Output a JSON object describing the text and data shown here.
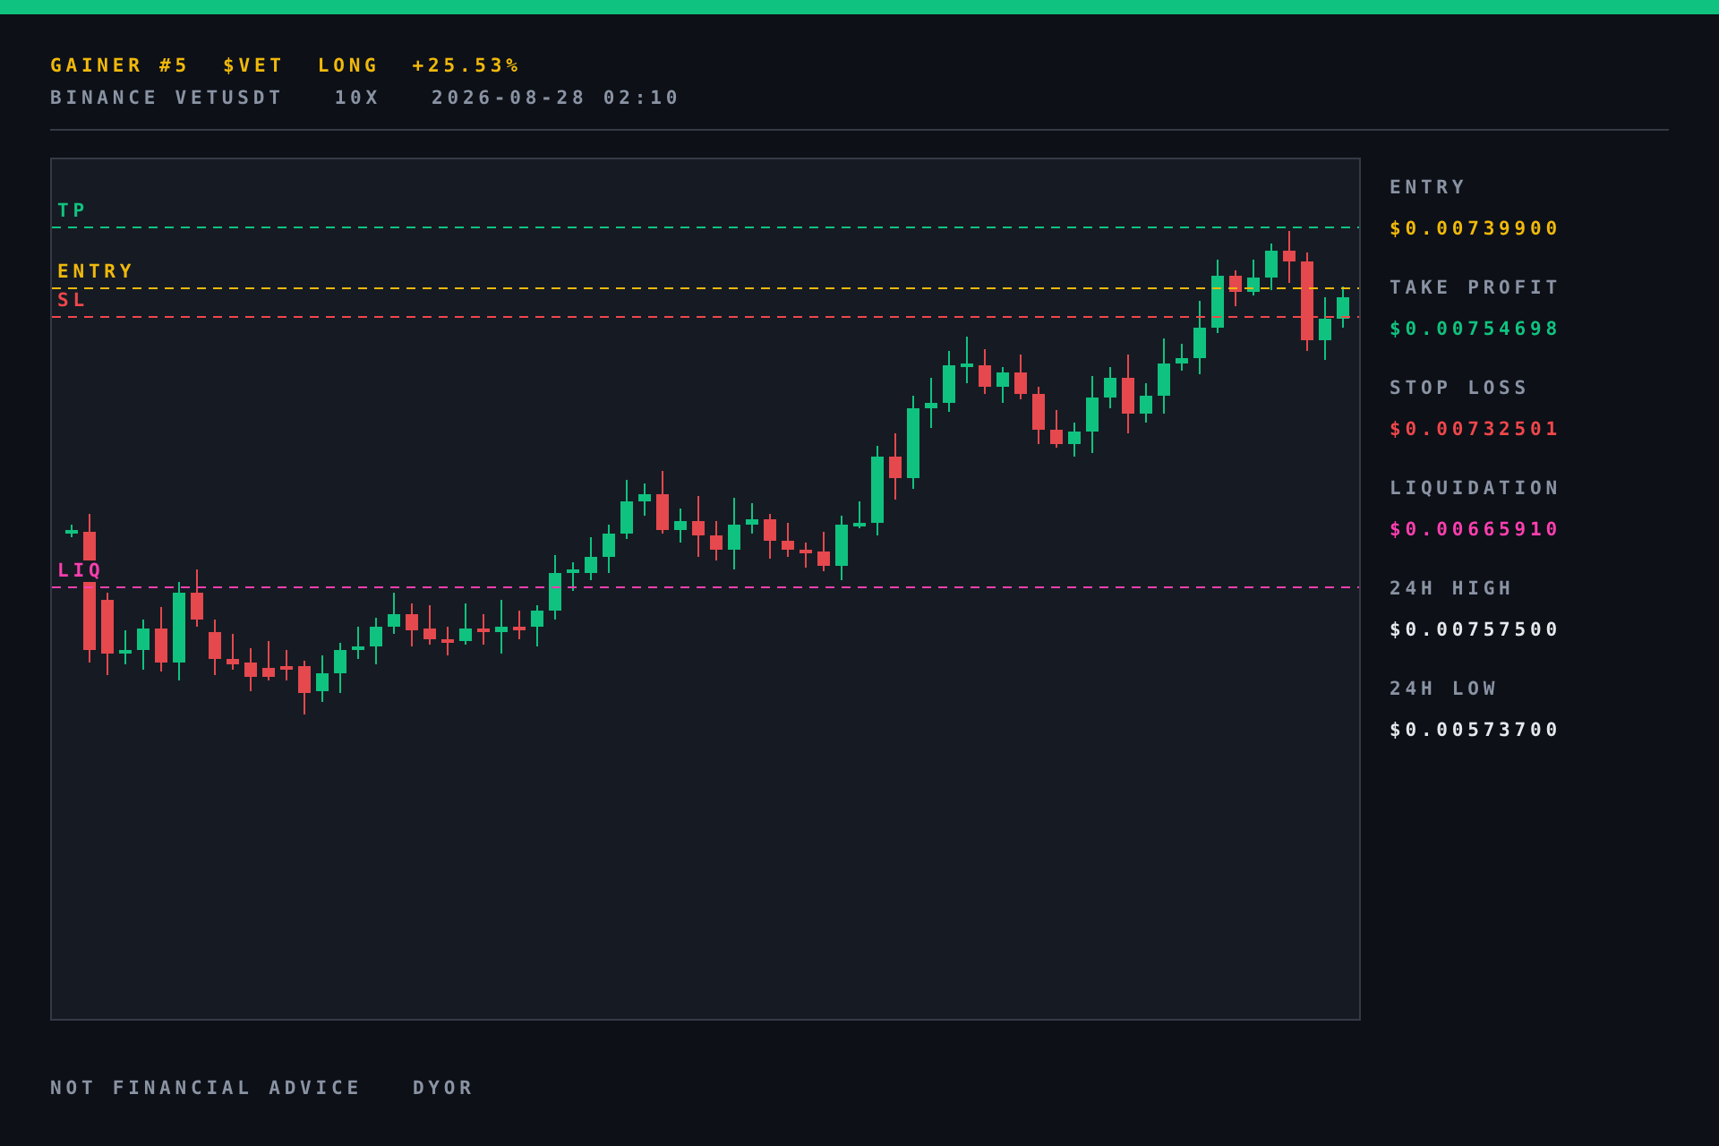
{
  "header": {
    "title_parts": [
      "GAINER #5",
      "$VET",
      "LONG",
      "+25.53%"
    ],
    "subtitle_parts": [
      "BINANCE VETUSDT",
      "10X",
      "2026-08-28 02:10"
    ]
  },
  "chart": {
    "levels": [
      {
        "kind": "tp",
        "label": "TP"
      },
      {
        "kind": "entry",
        "label": "ENTRY"
      },
      {
        "kind": "sl",
        "label": "SL"
      },
      {
        "kind": "liq",
        "label": "LIQ"
      }
    ]
  },
  "stats": [
    {
      "kind": "entry",
      "label": "ENTRY",
      "value": "$0.00739900"
    },
    {
      "kind": "tp",
      "label": "TAKE PROFIT",
      "value": "$0.00754698"
    },
    {
      "kind": "sl",
      "label": "STOP LOSS",
      "value": "$0.00732501"
    },
    {
      "kind": "liq",
      "label": "LIQUIDATION",
      "value": "$0.00665910"
    },
    {
      "kind": "plain",
      "label": "24H HIGH",
      "value": "$0.00757500"
    },
    {
      "kind": "plain",
      "label": "24H LOW",
      "value": "$0.00573700"
    }
  ],
  "footer": [
    "NOT FINANCIAL ADVICE",
    "DYOR"
  ]
}
